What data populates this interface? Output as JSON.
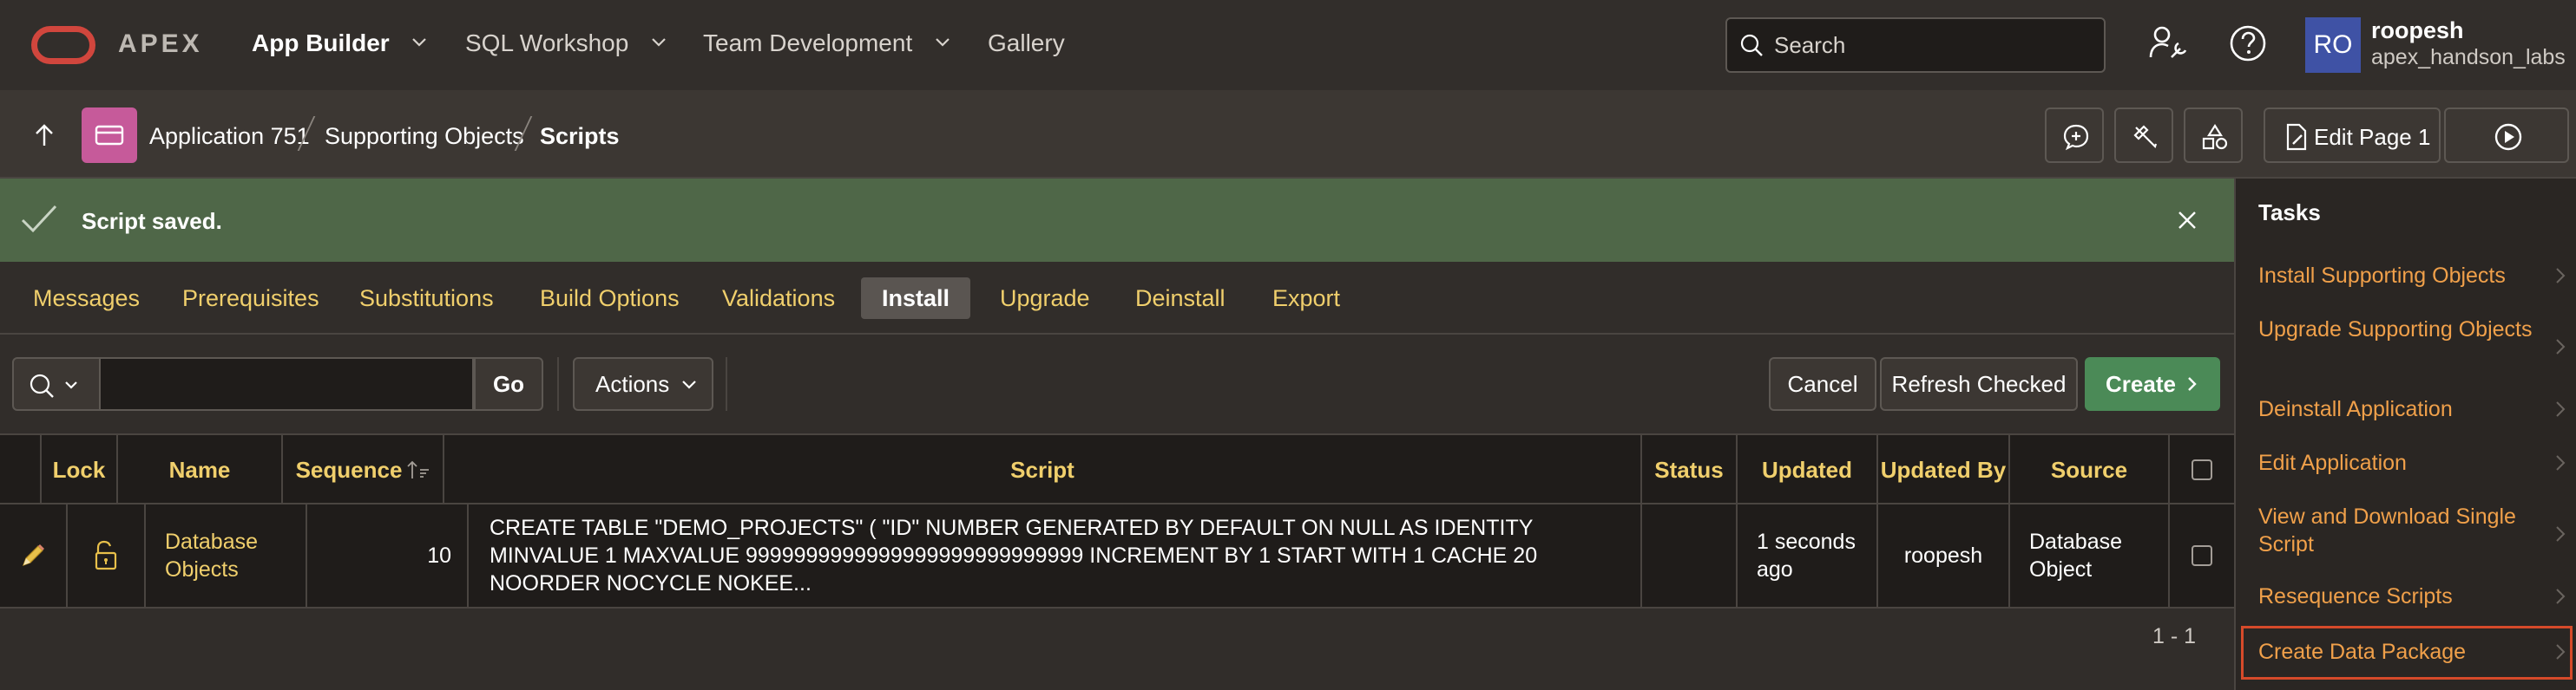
{
  "header": {
    "logo_text": "APEX",
    "nav": [
      {
        "label": "App Builder",
        "active": true,
        "has_menu": true
      },
      {
        "label": "SQL Workshop",
        "active": false,
        "has_menu": true
      },
      {
        "label": "Team Development",
        "active": false,
        "has_menu": true
      },
      {
        "label": "Gallery",
        "active": false,
        "has_menu": false
      }
    ],
    "search_placeholder": "Search",
    "user": {
      "initials": "RO",
      "name": "roopesh",
      "workspace": "apex_handson_labs"
    }
  },
  "breadcrumb": {
    "items": [
      "Application 751",
      "Supporting Objects",
      "Scripts"
    ],
    "edit_page_label": "Edit Page 1"
  },
  "alert": {
    "message": "Script saved."
  },
  "tabs": [
    "Messages",
    "Prerequisites",
    "Substitutions",
    "Build Options",
    "Validations",
    "Install",
    "Upgrade",
    "Deinstall",
    "Export"
  ],
  "active_tab": "Install",
  "toolbar": {
    "search_value": "",
    "go_label": "Go",
    "actions_label": "Actions",
    "cancel_label": "Cancel",
    "refresh_label": "Refresh Checked",
    "create_label": "Create"
  },
  "table": {
    "columns": [
      "Lock",
      "Name",
      "Sequence",
      "Script",
      "Status",
      "Updated",
      "Updated By",
      "Source"
    ],
    "rows": [
      {
        "name": "Database Objects",
        "sequence": "10",
        "script": "CREATE TABLE \"DEMO_PROJECTS\" ( \"ID\" NUMBER GENERATED BY DEFAULT ON NULL AS IDENTITY MINVALUE 1 MAXVALUE 9999999999999999999999999999 INCREMENT BY 1 START WITH 1 CACHE 20 NOORDER NOCYCLE NOKEE...",
        "status": "",
        "updated": "1 seconds ago",
        "updated_by": "roopesh",
        "source": "Database Object",
        "checked": false
      }
    ],
    "pagination": "1 - 1"
  },
  "sidebar": {
    "title": "Tasks",
    "items": [
      "Install Supporting Objects",
      "Upgrade Supporting Objects",
      "Deinstall Application",
      "Edit Application",
      "View and Download Single Script",
      "Resequence Scripts",
      "Create Data Package"
    ],
    "highlighted_item": "Create Data Package"
  },
  "colors": {
    "background": "#312d2a",
    "accent_link": "#f0cf6c",
    "task_link": "#f0a04a",
    "success_banner": "#4f6748",
    "create_button": "#4b8a57",
    "logo": "#d1463d",
    "avatar": "#3f52a5",
    "highlight": "#d64a2a"
  },
  "icons": [
    "apex-logo",
    "chevron-down-icon",
    "search-icon",
    "admin-wrench-icon",
    "help-icon",
    "up-arrow-icon",
    "app-icon",
    "comment-icon",
    "developer-tools-icon",
    "shapes-icon",
    "edit-page-icon",
    "run-icon",
    "check-icon",
    "close-icon",
    "sort-asc-icon",
    "edit-pencil-icon",
    "unlock-icon",
    "chevron-right-icon"
  ]
}
